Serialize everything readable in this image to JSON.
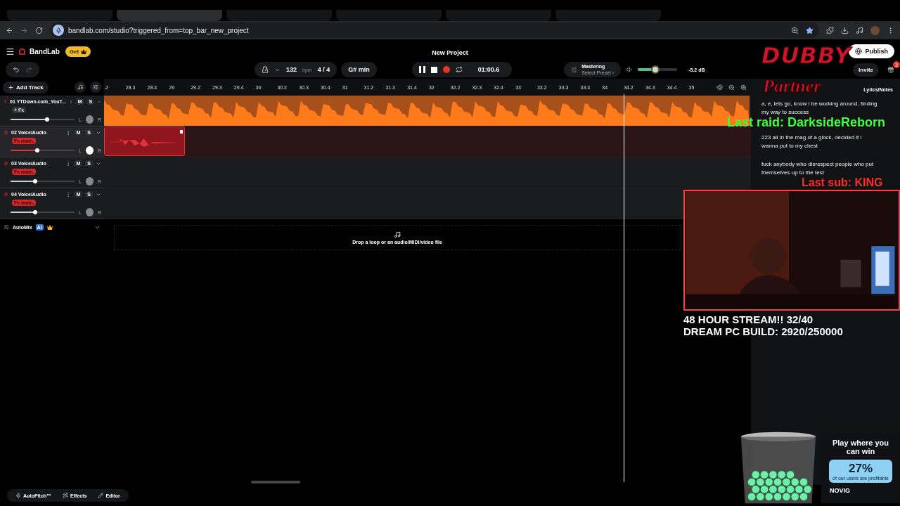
{
  "browser": {
    "tabs": [
      {
        "selected": false
      },
      {
        "selected": true
      },
      {
        "selected": false
      },
      {
        "selected": false
      },
      {
        "selected": false
      },
      {
        "selected": false
      }
    ],
    "url": "bandlab.com/studio?triggered_from=top_bar_new_project"
  },
  "header": {
    "brand": "BandLab",
    "get_badge": "Get",
    "title": "New Project",
    "publish": "Publish",
    "invite": "Invite",
    "notification_count": "3"
  },
  "controls": {
    "bpm": "132",
    "bpm_unit": "bpm",
    "time_sig": [
      "4",
      "/",
      "4"
    ],
    "key": "G# min",
    "playing": true,
    "time": "01:00.6",
    "mastering": "Mastering",
    "preset": "Select Preset ›",
    "volume": {
      "level": 0.45
    },
    "db": "-5.2 dB"
  },
  "toolbar": {
    "add_track": "Add Track"
  },
  "ruler": [
    ".2",
    "28.3",
    "28.4",
    "29",
    "29.2",
    "29.3",
    "29.4",
    "30",
    "30.2",
    "30.3",
    "30.4",
    "31",
    "31.2",
    "31.3",
    "31.4",
    "32",
    "32.2",
    "32.3",
    "32.4",
    "33",
    "33.2",
    "33.3",
    "33.4",
    "34",
    "34.2",
    "34.3",
    "34.4",
    "35"
  ],
  "tracks": [
    {
      "number": "01",
      "name": "YTDown.com_YouT...",
      "fx": {
        "kind": "add",
        "label": "+ Fx"
      },
      "mute": "M",
      "solo": "S",
      "pan_left": "L",
      "pan_right": "R",
      "selected": false,
      "clip": {
        "kind": "full"
      },
      "level": 0.57
    },
    {
      "number": "02",
      "name": "Voice/Audio",
      "fx": {
        "kind": "preset",
        "label": "Fx main."
      },
      "mute": "M",
      "solo": "S",
      "pan_left": "L",
      "pan_right": "R",
      "selected": true,
      "clip": {
        "kind": "short"
      },
      "level": 0.42
    },
    {
      "number": "03",
      "name": "Voice/Audio",
      "fx": {
        "kind": "preset",
        "label": "Fx main."
      },
      "mute": "M",
      "solo": "S",
      "pan_left": "L",
      "pan_right": "R",
      "selected": false,
      "clip": {
        "kind": "none"
      },
      "level": 0.38
    },
    {
      "number": "04",
      "name": "Voice/Audio",
      "fx": {
        "kind": "preset",
        "label": "Fx main."
      },
      "mute": "M",
      "solo": "S",
      "pan_left": "L",
      "pan_right": "R",
      "selected": false,
      "clip": {
        "kind": "none"
      },
      "level": 0.38
    }
  ],
  "automix": {
    "label": "AutoMix",
    "badge": "AI"
  },
  "drop_zone": {
    "text": "Drop a loop or an audio/MIDI/video file"
  },
  "lyrics": {
    "title": "Lyrics/Notes",
    "paragraphs": [
      "a, e, lets go, know i be working around, finding my way to success",
      "223 all in the mag of a glock, decided if i wanna put to my chest",
      "fuck anybody who disrespect people who put themselves up to the test"
    ]
  },
  "bottom_bar": [
    {
      "kind": "pitch",
      "label": "AutoPitch™"
    },
    {
      "kind": "effects",
      "label": "Effects"
    },
    {
      "kind": "editor",
      "label": "Editor"
    }
  ],
  "stream_overlay": {
    "logo": "DUBBY",
    "badge": "Partner",
    "last_raid": "Last raid: DarksideReborn",
    "last_sub": "Last sub: KING",
    "goals": [
      "48 HOUR STREAM!! 32/40",
      "DREAM PC BUILD: 2920/250000"
    ],
    "webcam": {
      "kind": "picture"
    }
  },
  "ad": {
    "headline": "Play where you can win",
    "stat": "27%",
    "stat_caption": "of our users are profitable",
    "brand": "NOVIG"
  }
}
